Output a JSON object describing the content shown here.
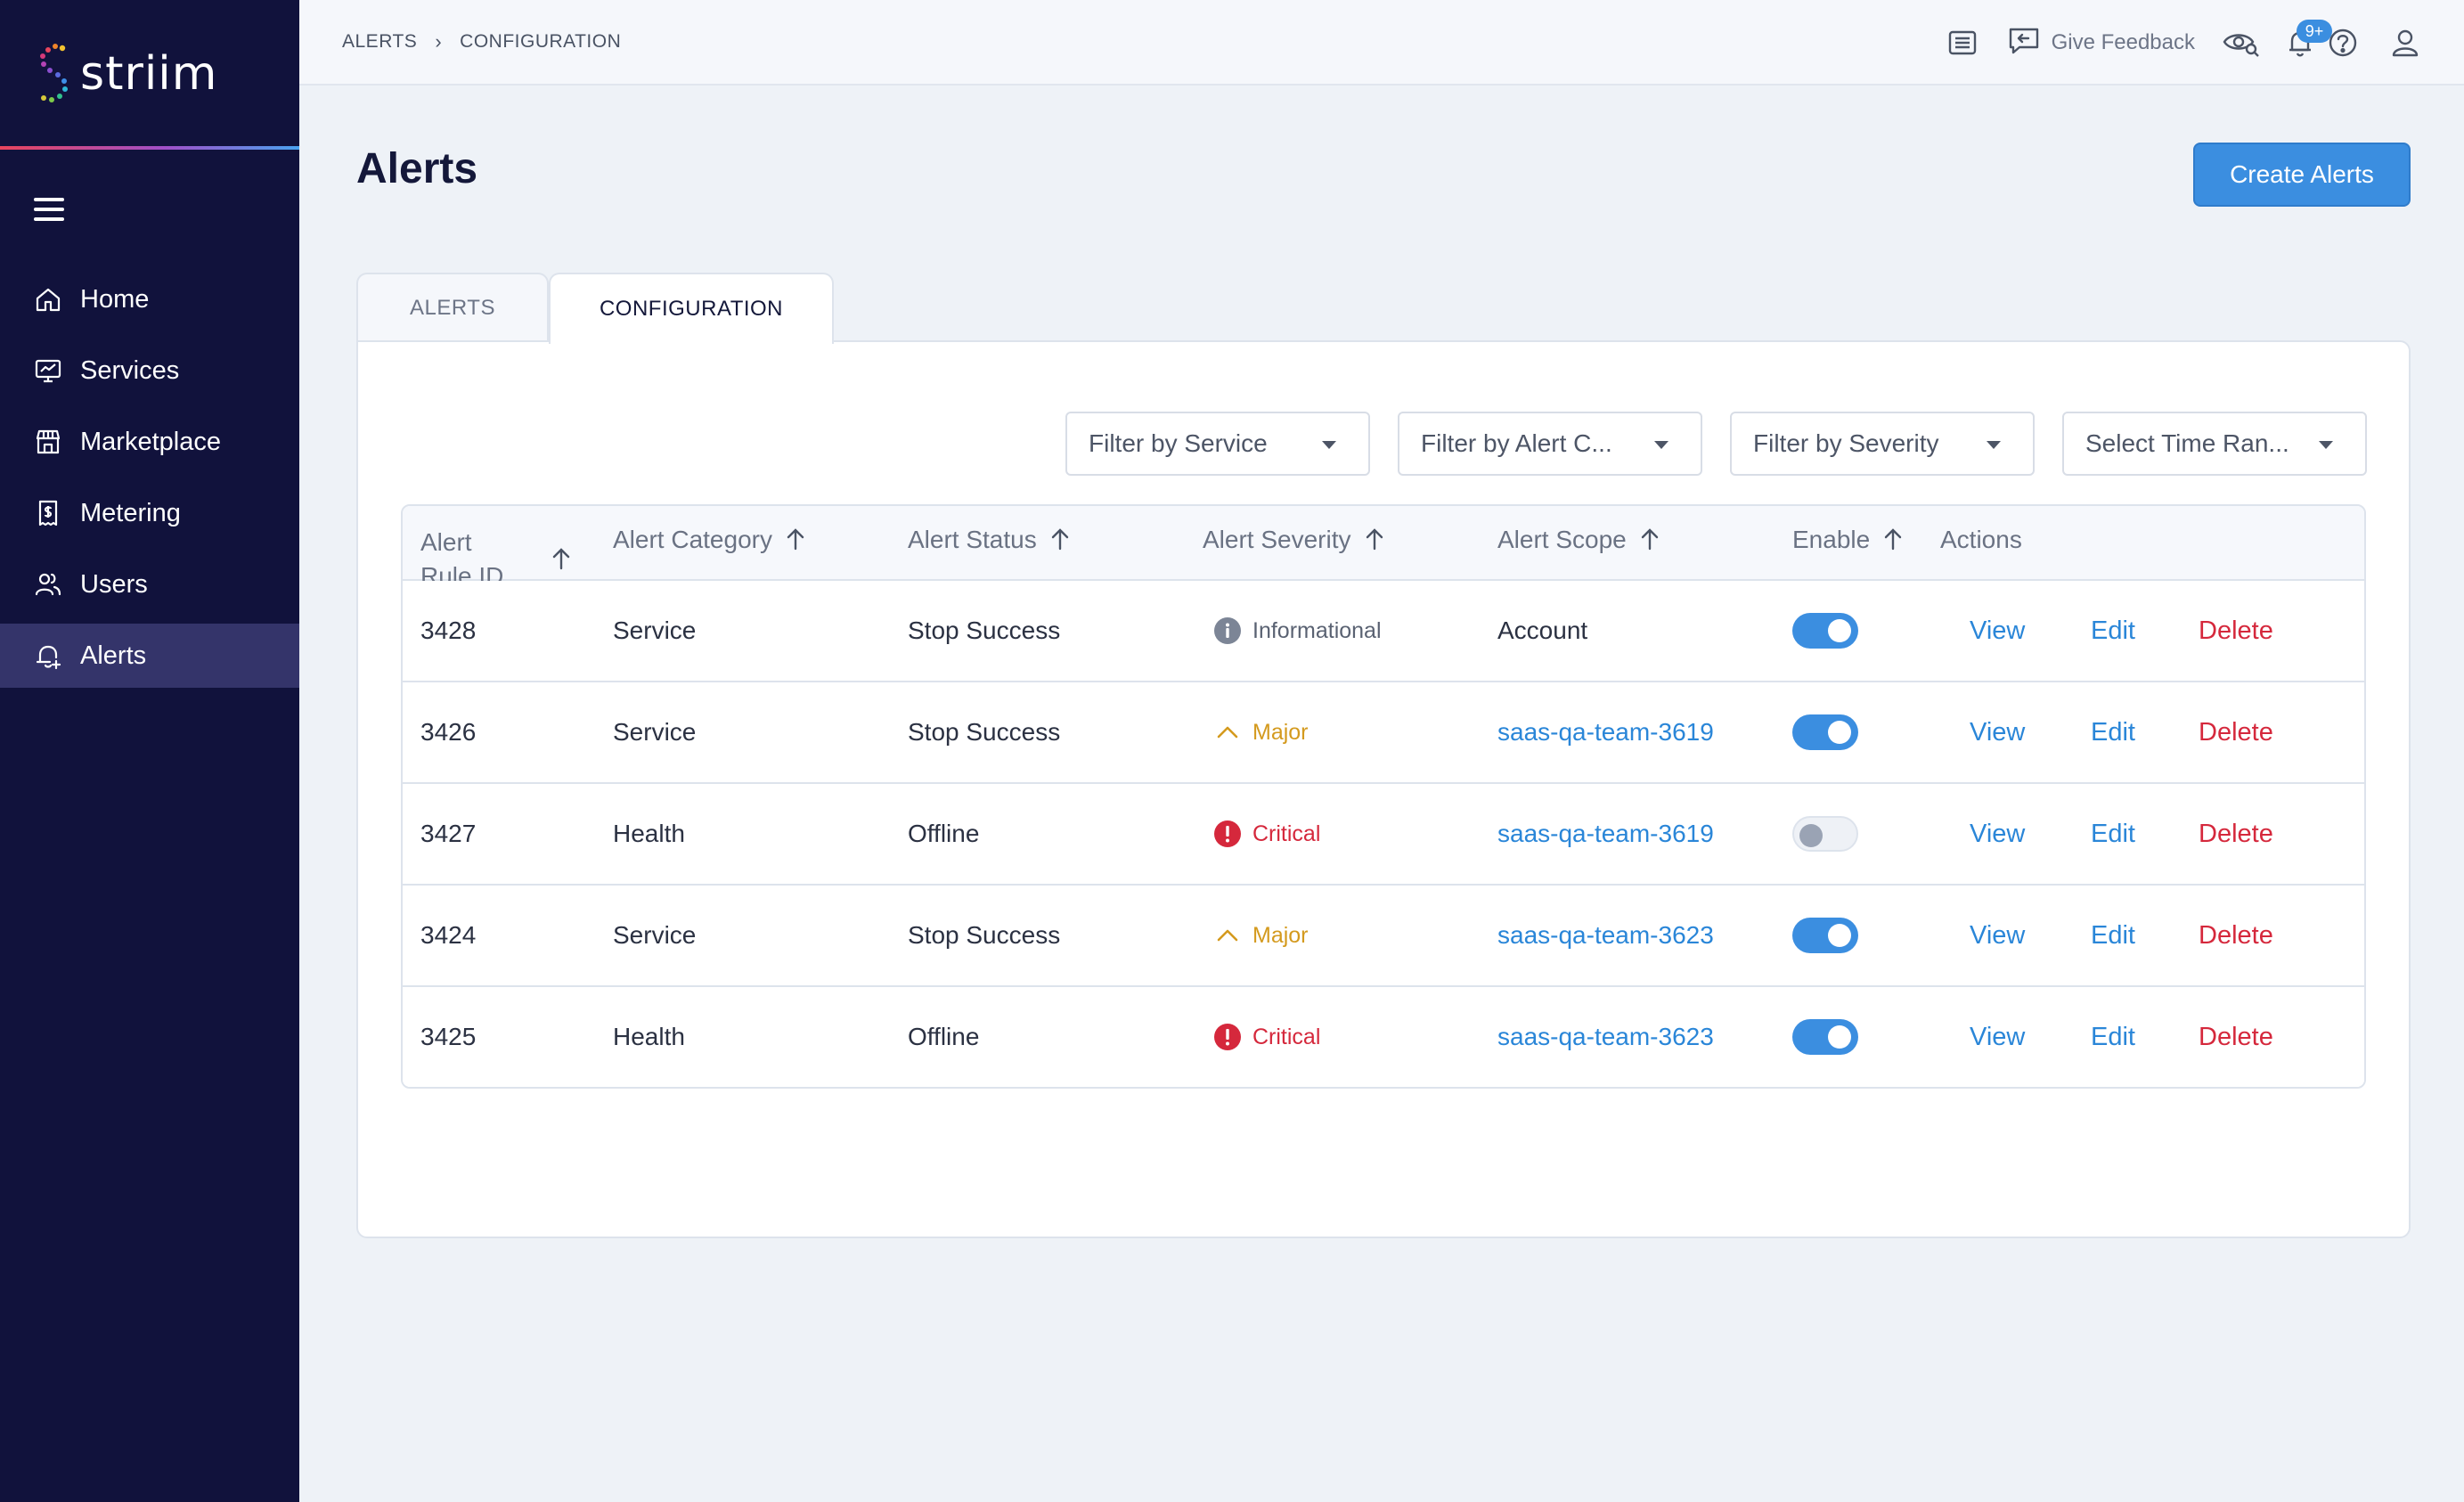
{
  "brand": {
    "name": "striim"
  },
  "sidebar": {
    "items": [
      {
        "label": "Home",
        "icon": "home-icon"
      },
      {
        "label": "Services",
        "icon": "monitor-chart-icon"
      },
      {
        "label": "Marketplace",
        "icon": "store-icon"
      },
      {
        "label": "Metering",
        "icon": "receipt-dollar-icon"
      },
      {
        "label": "Users",
        "icon": "users-icon"
      },
      {
        "label": "Alerts",
        "icon": "bell-plus-icon",
        "active": true
      }
    ]
  },
  "topbar": {
    "breadcrumb": [
      "ALERTS",
      "CONFIGURATION"
    ],
    "feedback_label": "Give Feedback",
    "notification_count": "9+"
  },
  "page": {
    "title": "Alerts",
    "create_button": "Create Alerts"
  },
  "tabs": [
    {
      "label": "ALERTS",
      "active": false
    },
    {
      "label": "CONFIGURATION",
      "active": true
    }
  ],
  "filters": [
    {
      "placeholder": "Filter by Service"
    },
    {
      "placeholder": "Filter by Alert C..."
    },
    {
      "placeholder": "Filter by Severity"
    },
    {
      "placeholder": "Select Time Ran..."
    }
  ],
  "table": {
    "columns": [
      "Alert Rule ID",
      "Alert Category",
      "Alert Status",
      "Alert Severity",
      "Alert Scope",
      "Enable",
      "Actions"
    ],
    "rows": [
      {
        "id": "3428",
        "category": "Service",
        "status": "Stop Success",
        "severity": "Informational",
        "scope": "Account",
        "enabled": true
      },
      {
        "id": "3426",
        "category": "Service",
        "status": "Stop Success",
        "severity": "Major",
        "scope": "saas-qa-team-3619",
        "enabled": true
      },
      {
        "id": "3427",
        "category": "Health",
        "status": "Offline",
        "severity": "Critical",
        "scope": "saas-qa-team-3619",
        "enabled": false
      },
      {
        "id": "3424",
        "category": "Service",
        "status": "Stop Success",
        "severity": "Major",
        "scope": "saas-qa-team-3623",
        "enabled": true
      },
      {
        "id": "3425",
        "category": "Health",
        "status": "Offline",
        "severity": "Critical",
        "scope": "saas-qa-team-3623",
        "enabled": true
      }
    ],
    "actions": {
      "view": "View",
      "edit": "Edit",
      "delete": "Delete"
    }
  },
  "colors": {
    "sidebar_bg": "#11123c",
    "accent": "#3b8ee0",
    "danger": "#d5283c",
    "warning": "#d49a1e"
  }
}
